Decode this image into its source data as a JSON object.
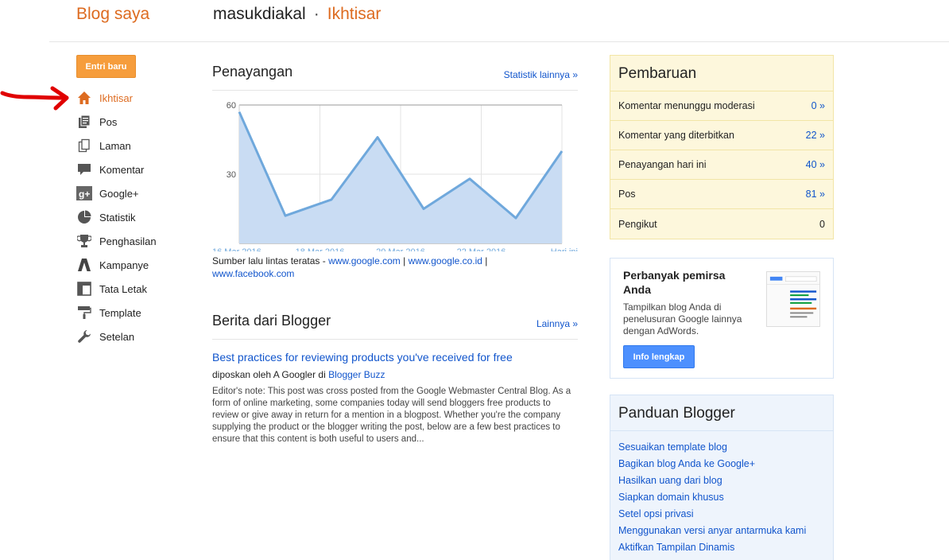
{
  "header": {
    "brand": "Blog saya",
    "blog_name": "masukdiakal",
    "separator": "·",
    "current_page": "Ikhtisar"
  },
  "sidebar": {
    "new_post_label": "Entri baru",
    "items": [
      {
        "label": "Ikhtisar",
        "icon": "home-icon",
        "active": true
      },
      {
        "label": "Pos",
        "icon": "posts-icon"
      },
      {
        "label": "Laman",
        "icon": "pages-icon"
      },
      {
        "label": "Komentar",
        "icon": "comment-icon"
      },
      {
        "label": "Google+",
        "icon": "google-plus-icon"
      },
      {
        "label": "Statistik",
        "icon": "pie-chart-icon"
      },
      {
        "label": "Penghasilan",
        "icon": "trophy-icon"
      },
      {
        "label": "Kampanye",
        "icon": "adwords-icon"
      },
      {
        "label": "Tata Letak",
        "icon": "layout-icon"
      },
      {
        "label": "Template",
        "icon": "paint-roller-icon"
      },
      {
        "label": "Setelan",
        "icon": "wrench-icon"
      }
    ]
  },
  "pageviews": {
    "title": "Penayangan",
    "more_link": "Statistik lainnya »",
    "traffic_prefix": "Sumber lalu lintas teratas - ",
    "sources": [
      "www.google.com",
      "www.google.co.id",
      "www.facebook.com"
    ],
    "source_sep": " | "
  },
  "chart_data": {
    "type": "area",
    "x": [
      "16 Mar 2016",
      "17 Mar 2016",
      "18 Mar 2016",
      "19 Mar 2016",
      "20 Mar 2016",
      "21 Mar 2016",
      "22 Mar 2016",
      "23 Mar 2016",
      "Hari ini"
    ],
    "tick_labels": [
      "16 Mar 2016",
      "18 Mar 2016",
      "20 Mar 2016",
      "22 Mar 2016",
      "Hari ini"
    ],
    "series": [
      {
        "values": [
          57,
          12,
          19,
          46,
          15,
          28,
          11,
          40
        ]
      }
    ],
    "y_ticks": [
      30,
      60
    ],
    "ylim": [
      0,
      60
    ],
    "grid": true,
    "line_color": "#6fa8dc",
    "fill_color": "#c9dcf3"
  },
  "news": {
    "title": "Berita dari Blogger",
    "more_link": "Lainnya »",
    "post_title": "Best practices for reviewing products you've received for free",
    "byline_prefix": "diposkan oleh A Googler di ",
    "byline_source": "Blogger Buzz",
    "excerpt": "Editor's note: This post was cross posted from the Google Webmaster Central Blog. As a form of online marketing, some companies today will send bloggers free products to review or give away in return for a mention in a blogpost. Whether you're the company supplying the product or the blogger writing the post, below are a few best practices to ensure that this content is both useful to users and..."
  },
  "updates": {
    "title": "Pembaruan",
    "rows": [
      {
        "label": "Komentar menunggu moderasi",
        "value": "0 »"
      },
      {
        "label": "Komentar yang diterbitkan",
        "value": "22 »"
      },
      {
        "label": "Penayangan hari ini",
        "value": "40 »"
      },
      {
        "label": "Pos",
        "value": "81 »"
      },
      {
        "label": "Pengikut",
        "value": "0"
      }
    ]
  },
  "promo": {
    "title": "Perbanyak pemirsa Anda",
    "text": "Tampilkan blog Anda di penelusuran Google lainnya dengan AdWords.",
    "button": "Info lengkap"
  },
  "guide": {
    "title": "Panduan Blogger",
    "links": [
      "Sesuaikan template blog",
      "Bagikan blog Anda ke Google+",
      "Hasilkan uang dari blog",
      "Siapkan domain khusus",
      "Setel opsi privasi",
      "Menggunakan versi anyar antarmuka kami",
      "Aktifkan Tampilan Dinamis"
    ]
  },
  "colors": {
    "accent": "#dd6b20",
    "link": "#1155cc",
    "orange_button": "#f69d3c",
    "blue_button": "#4d90fe",
    "annotation_arrow": "#e00000"
  }
}
